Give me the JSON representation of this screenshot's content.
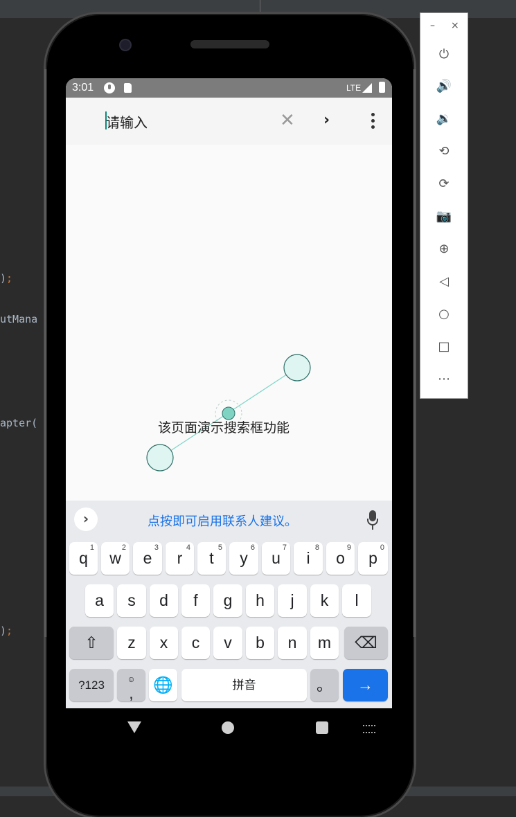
{
  "ide": {
    "code_fragments": [
      {
        "text": ")",
        "semi": ";"
      },
      {
        "text": "utMana",
        "semi": ""
      },
      {
        "text": "apter(",
        "semi": ""
      },
      {
        "text": ")",
        "semi": ";"
      }
    ]
  },
  "status_bar": {
    "time": "3:01",
    "network": "LTE"
  },
  "search": {
    "placeholder": "请输入",
    "clear_icon": "close-icon",
    "go_icon": "chevron-right-icon",
    "menu_icon": "more-vert-icon"
  },
  "content": {
    "demo_text": "该页面演示搜索框功能"
  },
  "keyboard": {
    "suggestion_hint": "点按即可启用联系人建议。",
    "expand_label": "›",
    "row1": [
      {
        "key": "q",
        "num": "1"
      },
      {
        "key": "w",
        "num": "2"
      },
      {
        "key": "e",
        "num": "3"
      },
      {
        "key": "r",
        "num": "4"
      },
      {
        "key": "t",
        "num": "5"
      },
      {
        "key": "y",
        "num": "6"
      },
      {
        "key": "u",
        "num": "7"
      },
      {
        "key": "i",
        "num": "8"
      },
      {
        "key": "o",
        "num": "9"
      },
      {
        "key": "p",
        "num": "0"
      }
    ],
    "row2": [
      "a",
      "s",
      "d",
      "f",
      "g",
      "h",
      "j",
      "k",
      "l"
    ],
    "row3": [
      "z",
      "x",
      "c",
      "v",
      "b",
      "n",
      "m"
    ],
    "shift_label": "⇧",
    "backspace_label": "⌫",
    "symbols_label": "?123",
    "comma_label": ",",
    "emoji_label": "☺",
    "globe_label": "🌐",
    "space_label": "拼音",
    "period_label": "。",
    "enter_label": "→"
  },
  "emulator_panel": {
    "minimize_label": "–",
    "close_label": "×",
    "buttons": [
      {
        "icon": "power-icon",
        "glyph": "⏻"
      },
      {
        "icon": "volume-up-icon",
        "glyph": "🔊"
      },
      {
        "icon": "volume-down-icon",
        "glyph": "🔉"
      },
      {
        "icon": "rotate-left-icon",
        "glyph": "⟲"
      },
      {
        "icon": "rotate-right-icon",
        "glyph": "⟳"
      },
      {
        "icon": "camera-icon",
        "glyph": "📷"
      },
      {
        "icon": "zoom-icon",
        "glyph": "⊕"
      },
      {
        "icon": "back-icon",
        "glyph": "◁"
      },
      {
        "icon": "home-icon",
        "glyph": "○"
      },
      {
        "icon": "overview-icon",
        "glyph": "□"
      },
      {
        "icon": "more-icon",
        "glyph": "⋯"
      }
    ]
  }
}
